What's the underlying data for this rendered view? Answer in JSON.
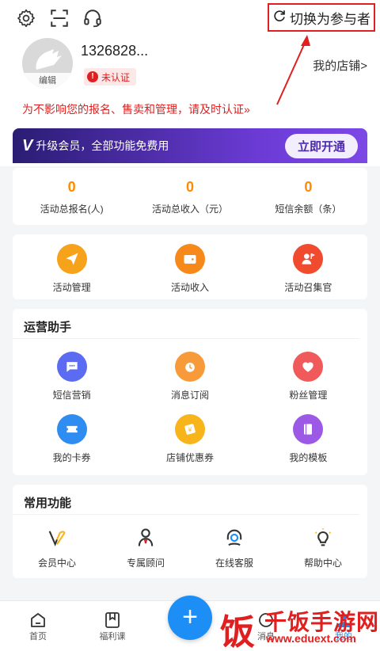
{
  "header": {
    "settings_icon": "gear-icon",
    "scan_icon": "scan-icon",
    "service_icon": "headset-icon",
    "switch_label": "切换为参与者",
    "switch_icon": "refresh-icon"
  },
  "profile": {
    "phone": "1326828...",
    "edit_label": "编辑",
    "status_label": "未认证",
    "my_store_label": "我的店铺>",
    "warning_text": "为不影响您的报名、售卖和管理，请及时认证»"
  },
  "vip": {
    "text": "升级会员，全部功能免费用",
    "button_label": "立即开通"
  },
  "stats": [
    {
      "value": "0",
      "label": "活动总报名(人)"
    },
    {
      "value": "0",
      "label": "活动总收入（元）"
    },
    {
      "value": "0",
      "label": "短信余额（条）"
    }
  ],
  "actions": [
    {
      "label": "活动管理",
      "icon": "send-icon",
      "color": "#f7a21b"
    },
    {
      "label": "活动收入",
      "icon": "wallet-icon",
      "color": "#f7891b"
    },
    {
      "label": "活动召集官",
      "icon": "user-flag-icon",
      "color": "#f04a2f"
    }
  ],
  "operations": {
    "title": "运营助手",
    "items": [
      {
        "label": "短信营销",
        "icon": "chat-icon",
        "color": "#5b6cf2"
      },
      {
        "label": "消息订阅",
        "icon": "clock-icon",
        "color": "#f79a3a"
      },
      {
        "label": "粉丝管理",
        "icon": "heart-icon",
        "color": "#f05a5a"
      },
      {
        "label": "我的卡券",
        "icon": "ticket-icon",
        "color": "#2f8cf0"
      },
      {
        "label": "店铺优惠券",
        "icon": "coupon-icon",
        "color": "#f7b41b"
      },
      {
        "label": "我的模板",
        "icon": "book-icon",
        "color": "#9b59e6"
      }
    ]
  },
  "common": {
    "title": "常用功能",
    "items": [
      {
        "label": "会员中心",
        "icon": "vip-icon"
      },
      {
        "label": "专属顾问",
        "icon": "person-icon"
      },
      {
        "label": "在线客服",
        "icon": "headset-icon"
      },
      {
        "label": "帮助中心",
        "icon": "bulb-icon"
      }
    ]
  },
  "tabbar": {
    "items": [
      {
        "label": "首页",
        "icon": "home-icon"
      },
      {
        "label": "福利课",
        "icon": "bookmark-icon"
      },
      {
        "label": "消息",
        "icon": "message-icon"
      },
      {
        "label": "我的",
        "icon": "profile-icon"
      }
    ],
    "fab_label": "+"
  },
  "watermark": {
    "char": "饭",
    "name": "千饭手游网",
    "url": "www.eduext.com"
  },
  "colors": {
    "accent": "#e02020",
    "orange": "#ff8a00",
    "blue": "#1e8ef7",
    "vip_purple": "#6c3bd6"
  }
}
